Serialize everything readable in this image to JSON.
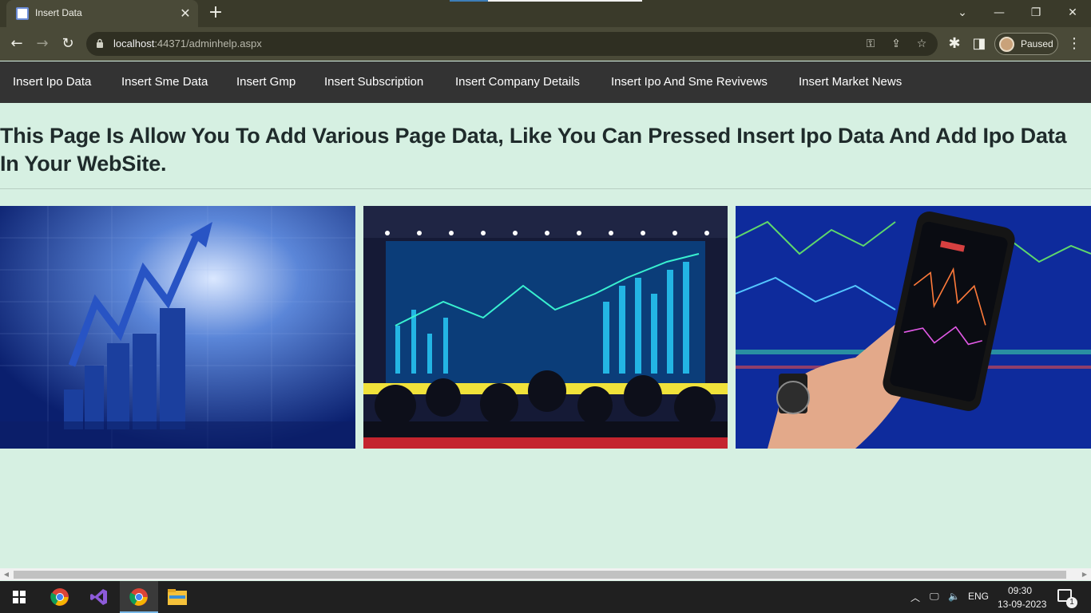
{
  "browser": {
    "tab_title": "Insert Data",
    "url_host": "localhost",
    "url_rest": ":44371/adminhelp.aspx",
    "profile_label": "Paused"
  },
  "site_nav": {
    "items": [
      "Insert Ipo Data",
      "Insert Sme Data",
      "Insert Gmp",
      "Insert Subscription",
      "Insert Company Details",
      "Insert Ipo And Sme Revivews",
      "Insert Market News"
    ]
  },
  "content": {
    "heading": "This Page Is Allow You To Add Various Page Data, Like You Can Pressed Insert Ipo Data And Add Ipo Data In Your WebSite."
  },
  "taskbar": {
    "lang": "ENG",
    "time": "09:30",
    "date": "13-09-2023",
    "notifications": "1"
  },
  "colors": {
    "page_bg": "#d6f0e2",
    "nav_bg": "#333333",
    "chrome_bg": "#4a4a38"
  }
}
